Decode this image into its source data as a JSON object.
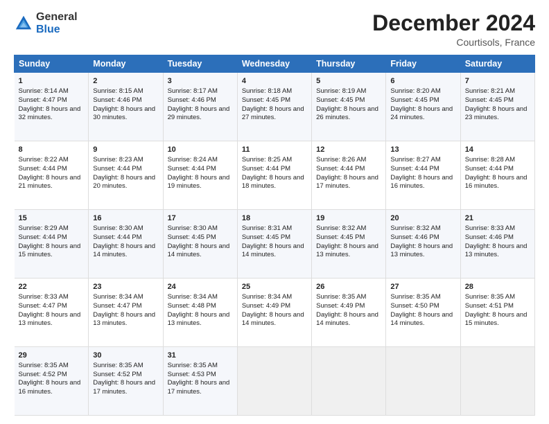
{
  "header": {
    "logo": {
      "general": "General",
      "blue": "Blue"
    },
    "title": "December 2024",
    "location": "Courtisols, France"
  },
  "days_of_week": [
    "Sunday",
    "Monday",
    "Tuesday",
    "Wednesday",
    "Thursday",
    "Friday",
    "Saturday"
  ],
  "weeks": [
    [
      {
        "day": "1",
        "sunrise": "8:14 AM",
        "sunset": "4:47 PM",
        "daylight": "8 hours and 32 minutes."
      },
      {
        "day": "2",
        "sunrise": "8:15 AM",
        "sunset": "4:46 PM",
        "daylight": "8 hours and 30 minutes."
      },
      {
        "day": "3",
        "sunrise": "8:17 AM",
        "sunset": "4:46 PM",
        "daylight": "8 hours and 29 minutes."
      },
      {
        "day": "4",
        "sunrise": "8:18 AM",
        "sunset": "4:45 PM",
        "daylight": "8 hours and 27 minutes."
      },
      {
        "day": "5",
        "sunrise": "8:19 AM",
        "sunset": "4:45 PM",
        "daylight": "8 hours and 26 minutes."
      },
      {
        "day": "6",
        "sunrise": "8:20 AM",
        "sunset": "4:45 PM",
        "daylight": "8 hours and 24 minutes."
      },
      {
        "day": "7",
        "sunrise": "8:21 AM",
        "sunset": "4:45 PM",
        "daylight": "8 hours and 23 minutes."
      }
    ],
    [
      {
        "day": "8",
        "sunrise": "8:22 AM",
        "sunset": "4:44 PM",
        "daylight": "8 hours and 21 minutes."
      },
      {
        "day": "9",
        "sunrise": "8:23 AM",
        "sunset": "4:44 PM",
        "daylight": "8 hours and 20 minutes."
      },
      {
        "day": "10",
        "sunrise": "8:24 AM",
        "sunset": "4:44 PM",
        "daylight": "8 hours and 19 minutes."
      },
      {
        "day": "11",
        "sunrise": "8:25 AM",
        "sunset": "4:44 PM",
        "daylight": "8 hours and 18 minutes."
      },
      {
        "day": "12",
        "sunrise": "8:26 AM",
        "sunset": "4:44 PM",
        "daylight": "8 hours and 17 minutes."
      },
      {
        "day": "13",
        "sunrise": "8:27 AM",
        "sunset": "4:44 PM",
        "daylight": "8 hours and 16 minutes."
      },
      {
        "day": "14",
        "sunrise": "8:28 AM",
        "sunset": "4:44 PM",
        "daylight": "8 hours and 16 minutes."
      }
    ],
    [
      {
        "day": "15",
        "sunrise": "8:29 AM",
        "sunset": "4:44 PM",
        "daylight": "8 hours and 15 minutes."
      },
      {
        "day": "16",
        "sunrise": "8:30 AM",
        "sunset": "4:44 PM",
        "daylight": "8 hours and 14 minutes."
      },
      {
        "day": "17",
        "sunrise": "8:30 AM",
        "sunset": "4:45 PM",
        "daylight": "8 hours and 14 minutes."
      },
      {
        "day": "18",
        "sunrise": "8:31 AM",
        "sunset": "4:45 PM",
        "daylight": "8 hours and 14 minutes."
      },
      {
        "day": "19",
        "sunrise": "8:32 AM",
        "sunset": "4:45 PM",
        "daylight": "8 hours and 13 minutes."
      },
      {
        "day": "20",
        "sunrise": "8:32 AM",
        "sunset": "4:46 PM",
        "daylight": "8 hours and 13 minutes."
      },
      {
        "day": "21",
        "sunrise": "8:33 AM",
        "sunset": "4:46 PM",
        "daylight": "8 hours and 13 minutes."
      }
    ],
    [
      {
        "day": "22",
        "sunrise": "8:33 AM",
        "sunset": "4:47 PM",
        "daylight": "8 hours and 13 minutes."
      },
      {
        "day": "23",
        "sunrise": "8:34 AM",
        "sunset": "4:47 PM",
        "daylight": "8 hours and 13 minutes."
      },
      {
        "day": "24",
        "sunrise": "8:34 AM",
        "sunset": "4:48 PM",
        "daylight": "8 hours and 13 minutes."
      },
      {
        "day": "25",
        "sunrise": "8:34 AM",
        "sunset": "4:49 PM",
        "daylight": "8 hours and 14 minutes."
      },
      {
        "day": "26",
        "sunrise": "8:35 AM",
        "sunset": "4:49 PM",
        "daylight": "8 hours and 14 minutes."
      },
      {
        "day": "27",
        "sunrise": "8:35 AM",
        "sunset": "4:50 PM",
        "daylight": "8 hours and 14 minutes."
      },
      {
        "day": "28",
        "sunrise": "8:35 AM",
        "sunset": "4:51 PM",
        "daylight": "8 hours and 15 minutes."
      }
    ],
    [
      {
        "day": "29",
        "sunrise": "8:35 AM",
        "sunset": "4:52 PM",
        "daylight": "8 hours and 16 minutes."
      },
      {
        "day": "30",
        "sunrise": "8:35 AM",
        "sunset": "4:52 PM",
        "daylight": "8 hours and 17 minutes."
      },
      {
        "day": "31",
        "sunrise": "8:35 AM",
        "sunset": "4:53 PM",
        "daylight": "8 hours and 17 minutes."
      },
      null,
      null,
      null,
      null
    ]
  ],
  "labels": {
    "sunrise": "Sunrise:",
    "sunset": "Sunset:",
    "daylight": "Daylight:"
  }
}
